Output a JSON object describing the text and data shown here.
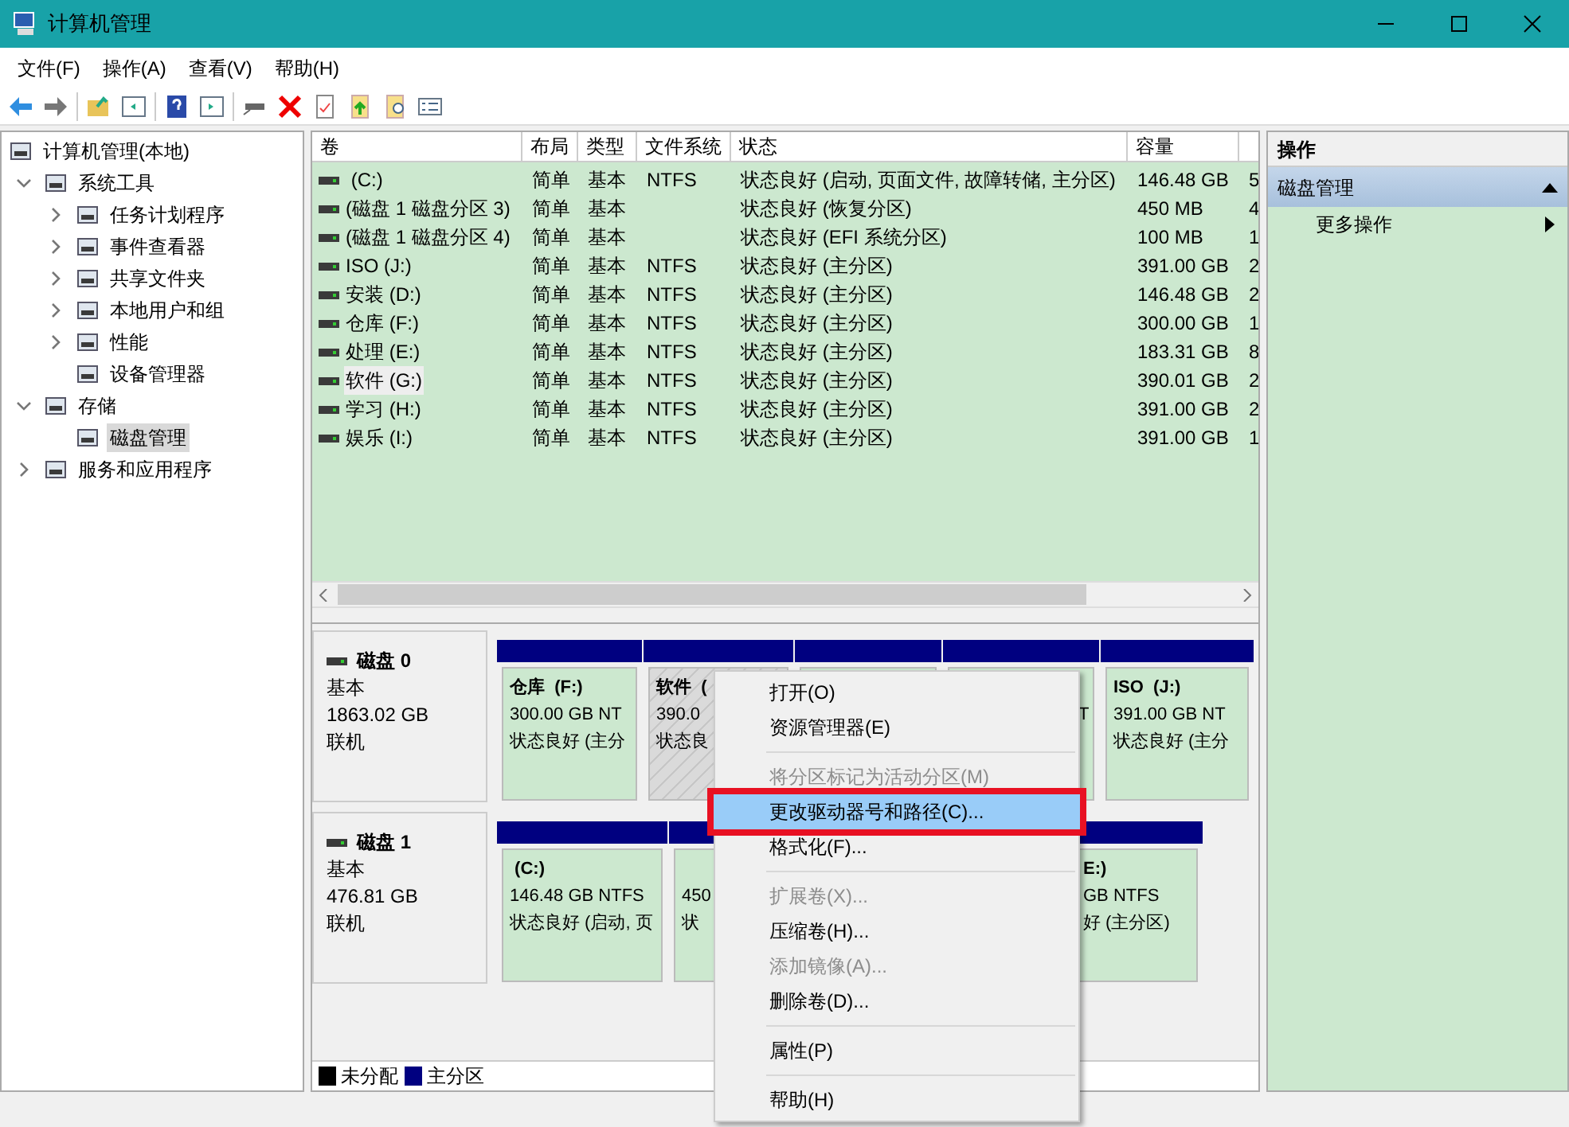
{
  "window": {
    "title": "计算机管理"
  },
  "menu_bar": [
    "文件(F)",
    "操作(A)",
    "查看(V)",
    "帮助(H)"
  ],
  "tree": [
    {
      "label": "计算机管理(本地)",
      "selected": false,
      "children": [
        {
          "label": "系统工具",
          "expanded": true,
          "selected": false,
          "children": [
            {
              "label": "任务计划程序",
              "expanded": false,
              "selected": false
            },
            {
              "label": "事件查看器",
              "expanded": false,
              "selected": false
            },
            {
              "label": "共享文件夹",
              "expanded": false,
              "selected": false
            },
            {
              "label": "本地用户和组",
              "expanded": false,
              "selected": false
            },
            {
              "label": "性能",
              "expanded": false,
              "selected": false
            },
            {
              "label": "设备管理器",
              "selected": false
            }
          ]
        },
        {
          "label": "存储",
          "expanded": true,
          "selected": false,
          "children": [
            {
              "label": "磁盘管理",
              "selected": true
            }
          ]
        },
        {
          "label": "服务和应用程序",
          "expanded": false,
          "selected": false
        }
      ]
    }
  ],
  "table": {
    "columns": [
      "卷",
      "布局",
      "类型",
      "文件系统",
      "状态",
      "容量"
    ],
    "rows": [
      {
        "cells": [
          " (C:)",
          "简单",
          "基本",
          "NTFS",
          "状态良好 (启动, 页面文件, 故障转储, 主分区)",
          "146.48 GB",
          "5"
        ],
        "selected": false
      },
      {
        "cells": [
          "(磁盘 1 磁盘分区 3)",
          "简单",
          "基本",
          "",
          "状态良好 (恢复分区)",
          "450 MB",
          "4"
        ],
        "selected": false
      },
      {
        "cells": [
          "(磁盘 1 磁盘分区 4)",
          "简单",
          "基本",
          "",
          "状态良好 (EFI 系统分区)",
          "100 MB",
          "1"
        ],
        "selected": false
      },
      {
        "cells": [
          "ISO (J:)",
          "简单",
          "基本",
          "NTFS",
          "状态良好 (主分区)",
          "391.00 GB",
          "2"
        ],
        "selected": false
      },
      {
        "cells": [
          "安装 (D:)",
          "简单",
          "基本",
          "NTFS",
          "状态良好 (主分区)",
          "146.48 GB",
          "2"
        ],
        "selected": false
      },
      {
        "cells": [
          "仓库 (F:)",
          "简单",
          "基本",
          "NTFS",
          "状态良好 (主分区)",
          "300.00 GB",
          "1"
        ],
        "selected": false
      },
      {
        "cells": [
          "处理 (E:)",
          "简单",
          "基本",
          "NTFS",
          "状态良好 (主分区)",
          "183.31 GB",
          "8"
        ],
        "selected": false
      },
      {
        "cells": [
          "软件 (G:)",
          "简单",
          "基本",
          "NTFS",
          "状态良好 (主分区)",
          "390.01 GB",
          "2"
        ],
        "selected": true
      },
      {
        "cells": [
          "学习 (H:)",
          "简单",
          "基本",
          "NTFS",
          "状态良好 (主分区)",
          "391.00 GB",
          "2"
        ],
        "selected": false
      },
      {
        "cells": [
          "娱乐 (I:)",
          "简单",
          "基本",
          "NTFS",
          "状态良好 (主分区)",
          "391.00 GB",
          "1"
        ],
        "selected": false
      }
    ]
  },
  "disks": [
    {
      "name": "磁盘 0",
      "type": "基本",
      "size": "1863.02 GB",
      "status": "联机",
      "partitions": [
        {
          "kind": "volume",
          "title": "仓库  (F:)",
          "size": "300.00 GB NT",
          "status": "状态良好 (主分",
          "selected": false
        },
        {
          "kind": "volume",
          "title": "软件  (",
          "size": "390.0",
          "status": "状态良",
          "selected": true
        },
        {
          "kind": "volume"
        },
        {
          "kind": "volume",
          "size": "T",
          "selected": false
        },
        {
          "kind": "volume",
          "title": "ISO  (J:)",
          "size": "391.00 GB NT",
          "status": "状态良好 (主分",
          "selected": false
        }
      ]
    },
    {
      "name": "磁盘 1",
      "type": "基本",
      "size": "476.81 GB",
      "status": "联机",
      "partitions": [
        {
          "kind": "volume",
          "title": " (C:)",
          "size": "146.48 GB NTFS",
          "status": "状态良好 (启动, 页",
          "selected": false
        },
        {
          "kind": "volume",
          "size": "450",
          "status": "状",
          "selected": false
        },
        {
          "kind": "volume",
          "title": "E:)",
          "size": "GB NTFS",
          "status": "好 (主分区)",
          "selected": false
        }
      ]
    }
  ],
  "legend": [
    {
      "label": "未分配",
      "color": "#000000"
    },
    {
      "label": "主分区",
      "color": "#000080"
    }
  ],
  "actions": {
    "title": "操作",
    "section": "磁盘管理",
    "items": [
      "更多操作"
    ]
  },
  "context_menu": [
    {
      "label": "打开(O)",
      "disabled": false,
      "selected": false
    },
    {
      "label": "资源管理器(E)",
      "disabled": false,
      "selected": false
    },
    {
      "kind": "separator"
    },
    {
      "label": "将分区标记为活动分区(M)",
      "disabled": true,
      "selected": false
    },
    {
      "label": "更改驱动器号和路径(C)...",
      "disabled": false,
      "selected": true
    },
    {
      "label": "格式化(F)...",
      "disabled": false,
      "selected": false
    },
    {
      "kind": "separator"
    },
    {
      "label": "扩展卷(X)...",
      "disabled": true,
      "selected": false
    },
    {
      "label": "压缩卷(H)...",
      "disabled": false,
      "selected": false
    },
    {
      "label": "添加镜像(A)...",
      "disabled": true,
      "selected": false
    },
    {
      "label": "删除卷(D)...",
      "disabled": false,
      "selected": false
    },
    {
      "kind": "separator"
    },
    {
      "label": "属性(P)",
      "disabled": false,
      "selected": false
    },
    {
      "kind": "separator"
    },
    {
      "label": "帮助(H)",
      "disabled": false,
      "selected": false
    }
  ]
}
